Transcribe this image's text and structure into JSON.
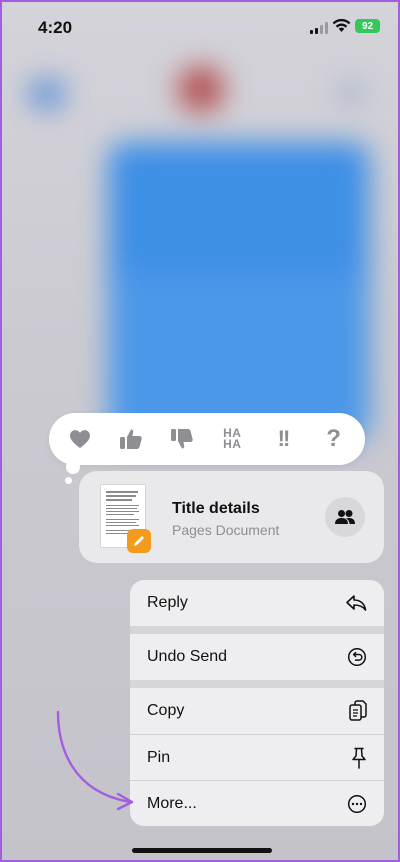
{
  "status_bar": {
    "time": "4:20",
    "battery": "92"
  },
  "tapback": {
    "haha_top": "HA",
    "haha_bottom": "HA",
    "emphasis": "!!",
    "question": "?"
  },
  "message": {
    "title": "Title details",
    "subtitle": "Pages Document"
  },
  "menu": {
    "reply": "Reply",
    "undo_send": "Undo Send",
    "copy": "Copy",
    "pin": "Pin",
    "more": "More..."
  },
  "colors": {
    "battery": "#35c759",
    "pages_badge": "#f29b1c",
    "annotation_arrow": "#a55de0",
    "frame_border": "#a55de0"
  }
}
